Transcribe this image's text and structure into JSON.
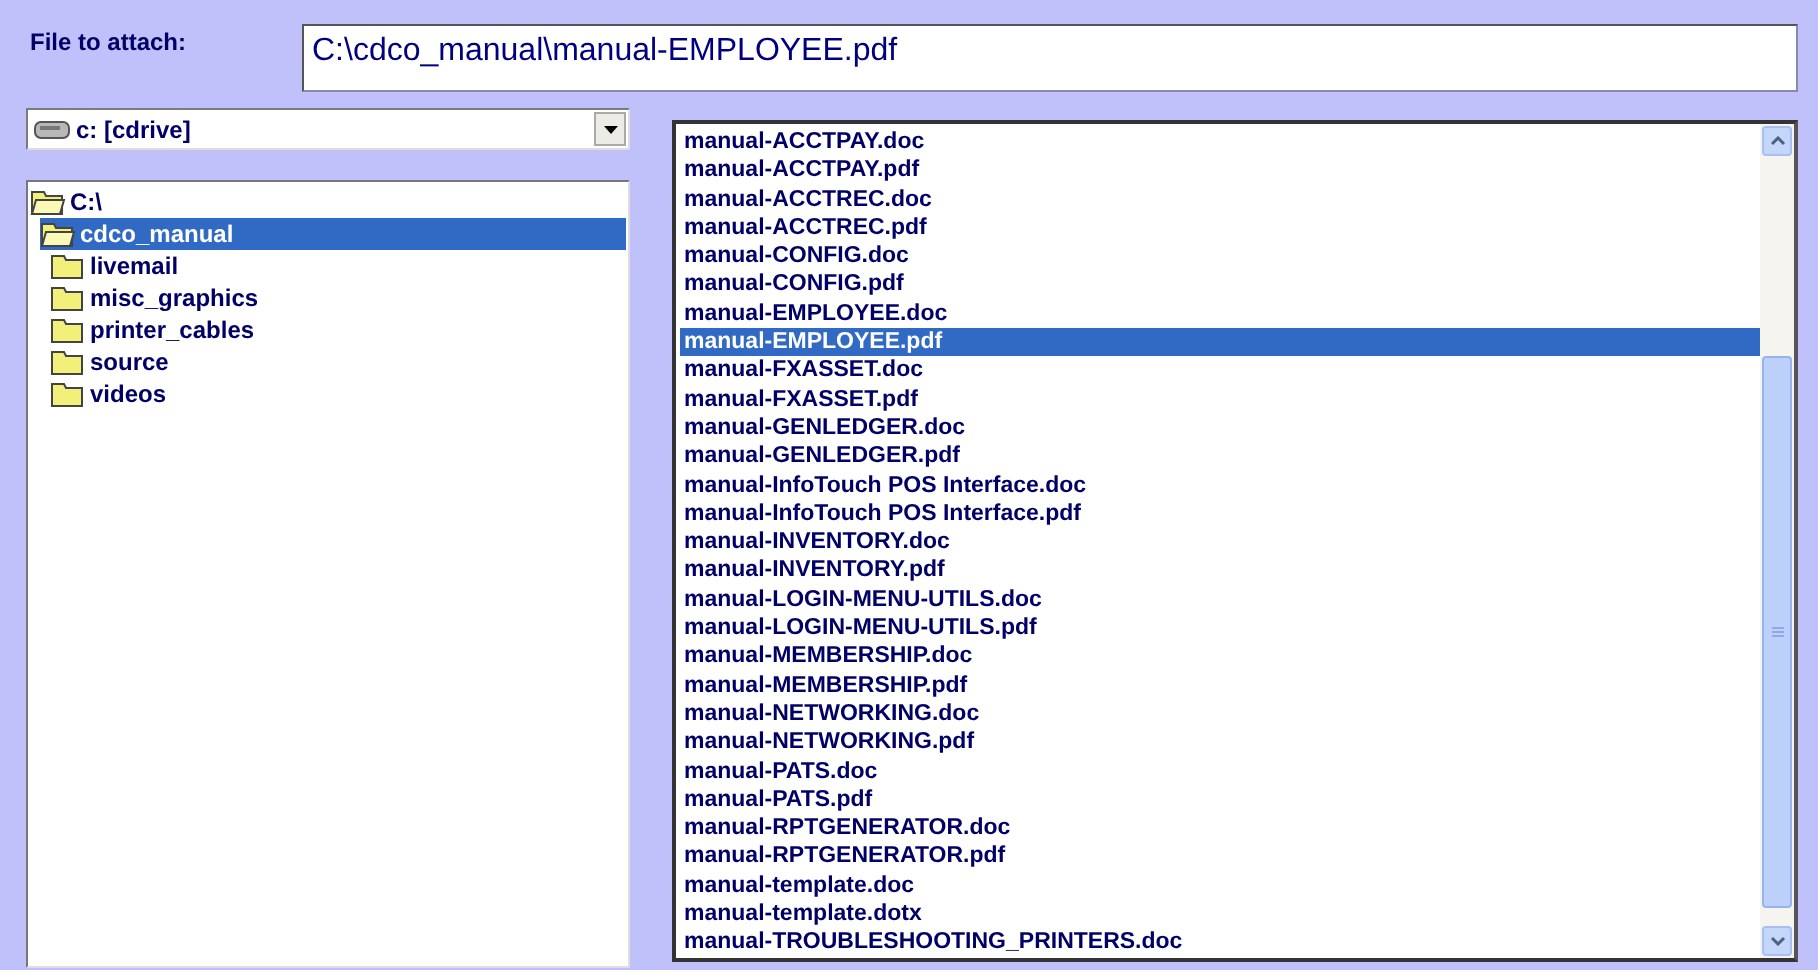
{
  "attach": {
    "label": "File to attach:",
    "value": "C:\\cdco_manual\\manual-EMPLOYEE.pdf"
  },
  "drive": {
    "value": "c: [cdrive]"
  },
  "tree": [
    {
      "name": "C:\\",
      "open": true,
      "selected": false,
      "children": [
        {
          "name": "cdco_manual",
          "open": true,
          "selected": true,
          "children": [
            {
              "name": "livemail",
              "open": false,
              "selected": false
            },
            {
              "name": "misc_graphics",
              "open": false,
              "selected": false
            },
            {
              "name": "printer_cables",
              "open": false,
              "selected": false
            },
            {
              "name": "source",
              "open": false,
              "selected": false
            },
            {
              "name": "videos",
              "open": false,
              "selected": false
            }
          ]
        }
      ]
    }
  ],
  "files": [
    {
      "name": "manual-ACCTPAY.doc",
      "selected": false
    },
    {
      "name": "manual-ACCTPAY.pdf",
      "selected": false
    },
    {
      "name": "manual-ACCTREC.doc",
      "selected": false
    },
    {
      "name": "manual-ACCTREC.pdf",
      "selected": false
    },
    {
      "name": "manual-CONFIG.doc",
      "selected": false
    },
    {
      "name": "manual-CONFIG.pdf",
      "selected": false
    },
    {
      "name": "manual-EMPLOYEE.doc",
      "selected": false
    },
    {
      "name": "manual-EMPLOYEE.pdf",
      "selected": true
    },
    {
      "name": "manual-FXASSET.doc",
      "selected": false
    },
    {
      "name": "manual-FXASSET.pdf",
      "selected": false
    },
    {
      "name": "manual-GENLEDGER.doc",
      "selected": false
    },
    {
      "name": "manual-GENLEDGER.pdf",
      "selected": false
    },
    {
      "name": "manual-InfoTouch POS Interface.doc",
      "selected": false
    },
    {
      "name": "manual-InfoTouch POS Interface.pdf",
      "selected": false
    },
    {
      "name": "manual-INVENTORY.doc",
      "selected": false
    },
    {
      "name": "manual-INVENTORY.pdf",
      "selected": false
    },
    {
      "name": "manual-LOGIN-MENU-UTILS.doc",
      "selected": false
    },
    {
      "name": "manual-LOGIN-MENU-UTILS.pdf",
      "selected": false
    },
    {
      "name": "manual-MEMBERSHIP.doc",
      "selected": false
    },
    {
      "name": "manual-MEMBERSHIP.pdf",
      "selected": false
    },
    {
      "name": "manual-NETWORKING.doc",
      "selected": false
    },
    {
      "name": "manual-NETWORKING.pdf",
      "selected": false
    },
    {
      "name": "manual-PATS.doc",
      "selected": false
    },
    {
      "name": "manual-PATS.pdf",
      "selected": false
    },
    {
      "name": "manual-RPTGENERATOR.doc",
      "selected": false
    },
    {
      "name": "manual-RPTGENERATOR.pdf",
      "selected": false
    },
    {
      "name": "manual-template.doc",
      "selected": false
    },
    {
      "name": "manual-template.dotx",
      "selected": false
    },
    {
      "name": "manual-TROUBLESHOOTING_PRINTERS.doc",
      "selected": false
    }
  ]
}
